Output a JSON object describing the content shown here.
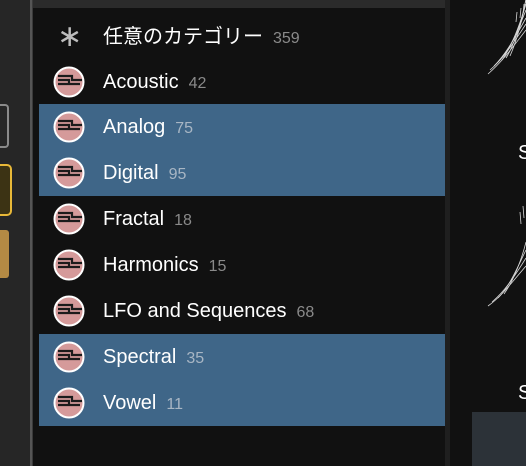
{
  "categories": [
    {
      "label": "任意のカテゴリー",
      "count": "359",
      "icon": "asterisk-icon",
      "selected": false
    },
    {
      "label": "Acoustic",
      "count": "42",
      "icon": "wavetable-category-icon",
      "selected": false
    },
    {
      "label": "Analog",
      "count": "75",
      "icon": "wavetable-category-icon",
      "selected": true
    },
    {
      "label": "Digital",
      "count": "95",
      "icon": "wavetable-category-icon",
      "selected": true
    },
    {
      "label": "Fractal",
      "count": "18",
      "icon": "wavetable-category-icon",
      "selected": false
    },
    {
      "label": "Harmonics",
      "count": "15",
      "icon": "wavetable-category-icon",
      "selected": false
    },
    {
      "label": "LFO and Sequences",
      "count": "68",
      "icon": "wavetable-category-icon",
      "selected": false
    },
    {
      "label": "Spectral",
      "count": "35",
      "icon": "wavetable-category-icon",
      "selected": true
    },
    {
      "label": "Vowel",
      "count": "11",
      "icon": "wavetable-category-icon",
      "selected": true
    }
  ],
  "preview": {
    "letter_top": "S",
    "letter_bottom": "S"
  },
  "colors": {
    "selected_row": "#3f6688",
    "panel_bg": "#111111",
    "icon_fill": "#d59a9a",
    "accent_border": "#e8b838"
  }
}
